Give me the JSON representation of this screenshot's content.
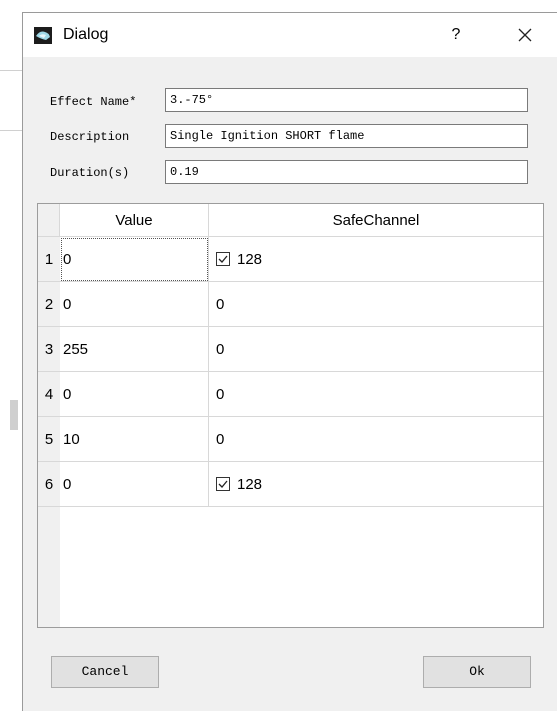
{
  "window": {
    "title": "Dialog",
    "help_label": "?",
    "app_icon": "app-icon",
    "close_icon": "close-icon"
  },
  "form": {
    "effect_name_label": "Effect Name*",
    "effect_name_value": "3.-75°",
    "description_label": "Description",
    "description_value": "Single Ignition SHORT flame",
    "duration_label": "Duration(s)",
    "duration_value": "0.19"
  },
  "table": {
    "headers": [
      "Value",
      "SafeChannel"
    ],
    "rows": [
      {
        "num": "1",
        "value": "0",
        "safe": "128",
        "checked": true
      },
      {
        "num": "2",
        "value": "0",
        "safe": "0",
        "checked": false
      },
      {
        "num": "3",
        "value": "255",
        "safe": "0",
        "checked": false
      },
      {
        "num": "4",
        "value": "0",
        "safe": "0",
        "checked": false
      },
      {
        "num": "5",
        "value": "10",
        "safe": "0",
        "checked": false
      },
      {
        "num": "6",
        "value": "0",
        "safe": "128",
        "checked": true
      }
    ]
  },
  "buttons": {
    "cancel": "Cancel",
    "ok": "Ok"
  }
}
